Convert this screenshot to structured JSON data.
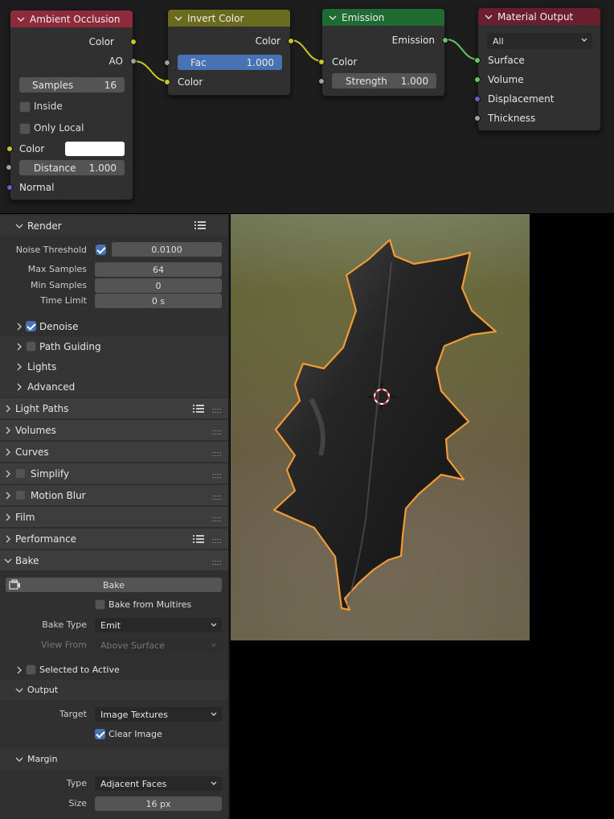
{
  "node_editor": {
    "nodes": {
      "ambient_occlusion": {
        "title": "Ambient Occlusion",
        "header_color": "#8f2a3c",
        "outputs": [
          "Color",
          "AO"
        ],
        "samples": {
          "label": "Samples",
          "value": "16"
        },
        "inside": {
          "label": "Inside",
          "checked": false
        },
        "only_local": {
          "label": "Only Local",
          "checked": false
        },
        "color_input": {
          "label": "Color",
          "swatch": "#ffffff"
        },
        "distance": {
          "label": "Distance",
          "value": "1.000"
        },
        "normal": {
          "label": "Normal"
        }
      },
      "invert_color": {
        "title": "Invert Color",
        "header_color": "#6b6b1f",
        "output": "Color",
        "fac": {
          "label": "Fac",
          "value": "1.000"
        },
        "color_input": "Color"
      },
      "emission": {
        "title": "Emission",
        "header_color": "#1f6b32",
        "output": "Emission",
        "color_input": "Color",
        "strength": {
          "label": "Strength",
          "value": "1.000"
        }
      },
      "material_output": {
        "title": "Material Output",
        "header_color": "#6b1f2e",
        "target": "All",
        "inputs": [
          "Surface",
          "Volume",
          "Displacement",
          "Thickness"
        ]
      }
    }
  },
  "properties": {
    "render": {
      "label": "Render",
      "noise_threshold": {
        "label": "Noise Threshold",
        "checked": true,
        "value": "0.0100"
      },
      "max_samples": {
        "label": "Max Samples",
        "value": "64"
      },
      "min_samples": {
        "label": "Min Samples",
        "value": "0"
      },
      "time_limit": {
        "label": "Time Limit",
        "value": "0 s"
      },
      "denoise": {
        "label": "Denoise",
        "checked": true
      },
      "path_guiding": {
        "label": "Path Guiding",
        "checked": false
      },
      "lights": {
        "label": "Lights"
      },
      "advanced": {
        "label": "Advanced"
      }
    },
    "panels": {
      "light_paths": "Light Paths",
      "volumes": "Volumes",
      "curves": "Curves",
      "simplify": "Simplify",
      "motion_blur": "Motion Blur",
      "film": "Film",
      "performance": "Performance",
      "bake": "Bake"
    },
    "bake": {
      "bake_button": "Bake",
      "bake_from_multires": {
        "label": "Bake from Multires",
        "checked": false
      },
      "bake_type": {
        "label": "Bake Type",
        "value": "Emit"
      },
      "view_from": {
        "label": "View From",
        "value": "Above Surface"
      },
      "selected_to_active": {
        "label": "Selected to Active",
        "checked": false
      },
      "output": {
        "label": "Output",
        "target": {
          "label": "Target",
          "value": "Image Textures"
        },
        "clear_image": {
          "label": "Clear Image",
          "checked": true
        }
      },
      "margin": {
        "label": "Margin",
        "type": {
          "label": "Type",
          "value": "Adjacent Faces"
        },
        "size": {
          "label": "Size",
          "value": "16 px"
        }
      }
    }
  },
  "colors": {
    "socket_yellow": "#c7c729",
    "socket_gray": "#a1a1a1",
    "socket_green": "#63c763",
    "socket_purple": "#6363c7",
    "accent_blue": "#4772b3",
    "selection_outline": "#f19a36"
  }
}
